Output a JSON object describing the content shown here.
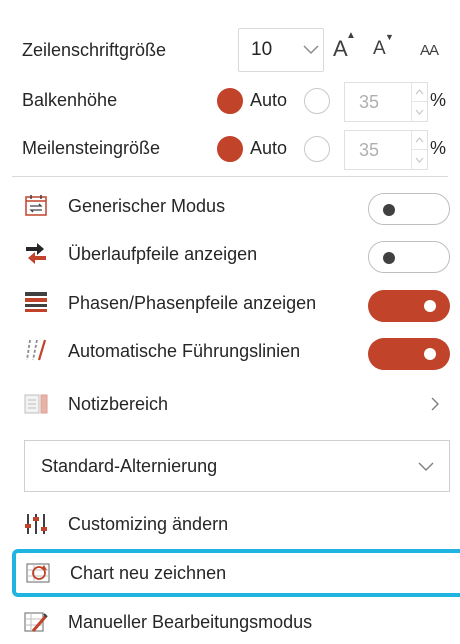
{
  "font_size_row": {
    "label": "Zeilenschriftgröße",
    "value": "10",
    "grow_glyph": "A",
    "shrink_glyph": "A",
    "case_glyph": "AA"
  },
  "bar_height_row": {
    "label": "Balkenhöhe",
    "auto_label": "Auto",
    "auto_selected": true,
    "spin_value": "35",
    "unit": "%"
  },
  "milestone_size_row": {
    "label": "Meilensteingröße",
    "auto_label": "Auto",
    "auto_selected": true,
    "spin_value": "35",
    "unit": "%"
  },
  "toggles": [
    {
      "label": "Generischer Modus",
      "icon": "calendar-swap-icon",
      "on": false
    },
    {
      "label": "Überlaufpfeile anzeigen",
      "icon": "overflow-arrows-icon",
      "on": false
    },
    {
      "label": "Phasen/Phasenpfeile anzeigen",
      "icon": "phase-bars-icon",
      "on": true
    },
    {
      "label": "Automatische Führungslinien",
      "icon": "leader-lines-icon",
      "on": true
    }
  ],
  "notes": {
    "label": "Notizbereich",
    "icon": "notes-area-icon",
    "chevron": "chevron-right-icon"
  },
  "alternation": {
    "selected": "Standard-Alternierung"
  },
  "actions": [
    {
      "label": "Customizing ändern",
      "icon": "customize-sliders-icon"
    },
    {
      "label": "Chart neu zeichnen",
      "icon": "redraw-chart-icon",
      "highlighted": true
    },
    {
      "label": "Manueller Bearbeitungsmodus",
      "icon": "manual-edit-icon"
    }
  ],
  "colors": {
    "accent": "#c0432a",
    "highlight": "#1fb5e0",
    "text": "#262626"
  }
}
